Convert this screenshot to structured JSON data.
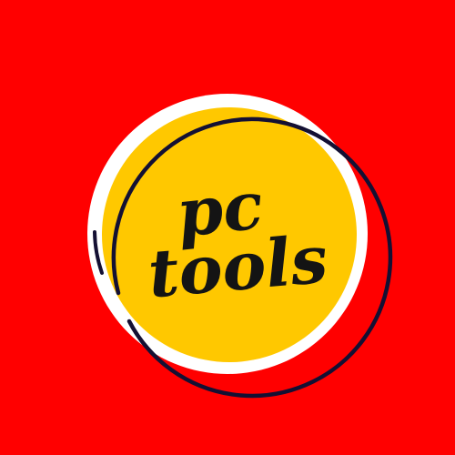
{
  "logo": {
    "line1": "pc",
    "line2": "tools"
  },
  "colors": {
    "background": "#ff0000",
    "badge_fill": "#ffc800",
    "badge_ring": "#ffffff",
    "outline": "#141033",
    "text": "#141414"
  }
}
